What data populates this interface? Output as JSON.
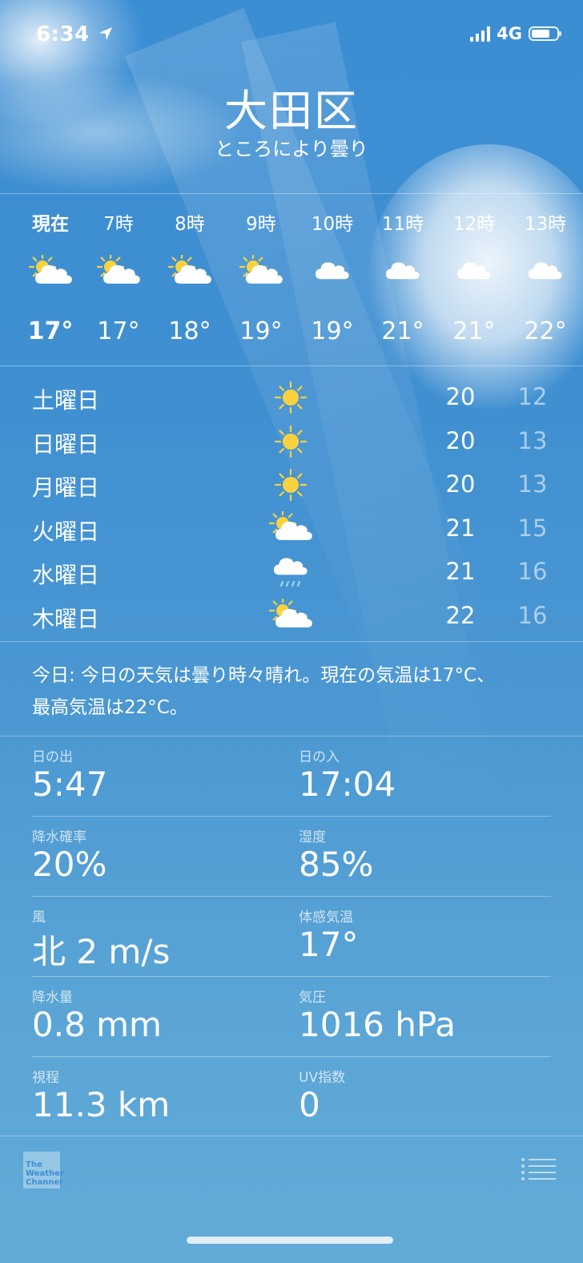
{
  "status_bar": {
    "time": "6:34",
    "network": "4G"
  },
  "header": {
    "city": "大田区",
    "condition": "ところにより曇り"
  },
  "hourly": [
    {
      "time": "現在",
      "icon": "partly-cloudy-icon",
      "temp": "17°"
    },
    {
      "time": "7時",
      "icon": "partly-cloudy-icon",
      "temp": "17°"
    },
    {
      "time": "8時",
      "icon": "partly-cloudy-icon",
      "temp": "18°"
    },
    {
      "time": "9時",
      "icon": "partly-cloudy-icon",
      "temp": "19°"
    },
    {
      "time": "10時",
      "icon": "cloud-icon",
      "temp": "19°"
    },
    {
      "time": "11時",
      "icon": "cloud-icon",
      "temp": "21°"
    },
    {
      "time": "12時",
      "icon": "cloud-icon",
      "temp": "21°"
    },
    {
      "time": "13時",
      "icon": "cloud-icon",
      "temp": "22°"
    }
  ],
  "daily": [
    {
      "day": "土曜日",
      "icon": "sun-icon",
      "high": "20",
      "low": "12"
    },
    {
      "day": "日曜日",
      "icon": "sun-icon",
      "high": "20",
      "low": "13"
    },
    {
      "day": "月曜日",
      "icon": "sun-icon",
      "high": "20",
      "low": "13"
    },
    {
      "day": "火曜日",
      "icon": "partly-cloudy-icon",
      "high": "21",
      "low": "15"
    },
    {
      "day": "水曜日",
      "icon": "rain-cloud-icon",
      "high": "21",
      "low": "16"
    },
    {
      "day": "木曜日",
      "icon": "partly-cloudy-icon",
      "high": "22",
      "low": "16"
    }
  ],
  "summary": {
    "line1": "今日: 今日の天気は曇り時々晴れ。現在の気温は17°C、",
    "line2": "最高気温は22°C。"
  },
  "details": [
    {
      "left_label": "日の出",
      "left_value": "5:47",
      "right_label": "日の入",
      "right_value": "17:04"
    },
    {
      "left_label": "降水確率",
      "left_value": "20%",
      "right_label": "湿度",
      "right_value": "85%"
    },
    {
      "left_label": "風",
      "left_value": "北 2 m/s",
      "right_label": "体感気温",
      "right_value": "17°"
    },
    {
      "left_label": "降水量",
      "left_value": "0.8 mm",
      "right_label": "気圧",
      "right_value": "1016 hPa"
    },
    {
      "left_label": "視程",
      "left_value": "11.3 km",
      "right_label": "UV指数",
      "right_value": "0"
    }
  ],
  "footer": {
    "logo_line1": "The",
    "logo_line2": "Weather",
    "logo_line3": "Channel"
  },
  "colors": {
    "sun": "#f7d23e",
    "sky_top": "#3c8ed3",
    "sky_bottom": "#62abd8"
  }
}
